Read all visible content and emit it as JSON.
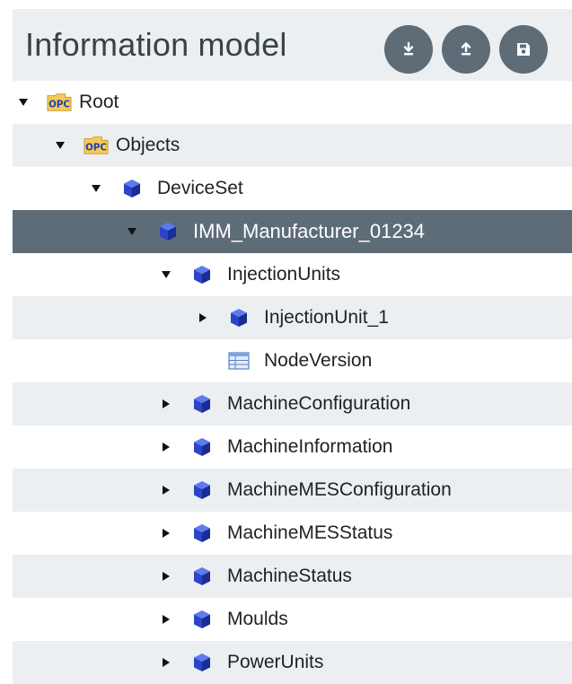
{
  "panel": {
    "title": "Information model",
    "buttons": [
      {
        "name": "download-button",
        "icon": "download-icon"
      },
      {
        "name": "upload-button",
        "icon": "upload-icon"
      },
      {
        "name": "save-button",
        "icon": "save-icon"
      }
    ]
  },
  "colors": {
    "header_bg": "#eceff1",
    "selected_bg": "#5e6c78",
    "button_bg": "#5e6c78",
    "cube": "#2b44c8",
    "opc_folder": "#f5c85a"
  },
  "tree": {
    "nodes": [
      {
        "label": "Root",
        "icon": "opc-folder-icon",
        "arrow": "down"
      },
      {
        "label": "Objects",
        "icon": "opc-folder-icon",
        "arrow": "down"
      },
      {
        "label": "DeviceSet",
        "icon": "object-cube-icon",
        "arrow": "down"
      },
      {
        "label": "IMM_Manufacturer_01234",
        "icon": "object-cube-icon",
        "arrow": "down",
        "selected": true
      },
      {
        "label": "InjectionUnits",
        "icon": "object-cube-icon",
        "arrow": "down"
      },
      {
        "label": "InjectionUnit_1",
        "icon": "object-cube-icon",
        "arrow": "right"
      },
      {
        "label": "NodeVersion",
        "icon": "variable-table-icon",
        "arrow": "none"
      },
      {
        "label": "MachineConfiguration",
        "icon": "object-cube-icon",
        "arrow": "right"
      },
      {
        "label": "MachineInformation",
        "icon": "object-cube-icon",
        "arrow": "right"
      },
      {
        "label": "MachineMESConfiguration",
        "icon": "object-cube-icon",
        "arrow": "right"
      },
      {
        "label": "MachineMESStatus",
        "icon": "object-cube-icon",
        "arrow": "right"
      },
      {
        "label": "MachineStatus",
        "icon": "object-cube-icon",
        "arrow": "right"
      },
      {
        "label": "Moulds",
        "icon": "object-cube-icon",
        "arrow": "right"
      },
      {
        "label": "PowerUnits",
        "icon": "object-cube-icon",
        "arrow": "right"
      }
    ]
  }
}
